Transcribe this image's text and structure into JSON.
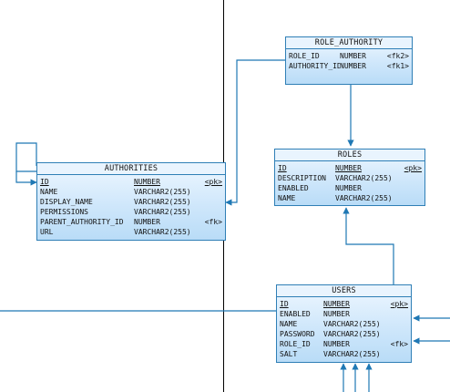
{
  "entities": {
    "role_authority": {
      "title": "ROLE_AUTHORITY",
      "columns": [
        {
          "name": "ROLE_ID",
          "type": "NUMBER",
          "key": "<fk2>",
          "pk": false
        },
        {
          "name": "AUTHORITY_ID",
          "type": "NUMBER",
          "key": "<fk1>",
          "pk": false
        }
      ]
    },
    "authorities": {
      "title": "AUTHORITIES",
      "columns": [
        {
          "name": "ID",
          "type": "NUMBER",
          "key": "<pk>",
          "pk": true
        },
        {
          "name": "NAME",
          "type": "VARCHAR2(255)",
          "key": "",
          "pk": false
        },
        {
          "name": "DISPLAY_NAME",
          "type": "VARCHAR2(255)",
          "key": "",
          "pk": false
        },
        {
          "name": "PERMISSIONS",
          "type": "VARCHAR2(255)",
          "key": "",
          "pk": false
        },
        {
          "name": "PARENT_AUTHORITY_ID",
          "type": "NUMBER",
          "key": "<fk>",
          "pk": false
        },
        {
          "name": "URL",
          "type": "VARCHAR2(255)",
          "key": "",
          "pk": false
        }
      ]
    },
    "roles": {
      "title": "ROLES",
      "columns": [
        {
          "name": "ID",
          "type": "NUMBER",
          "key": "<pk>",
          "pk": true
        },
        {
          "name": "DESCRIPTION",
          "type": "VARCHAR2(255)",
          "key": "",
          "pk": false
        },
        {
          "name": "ENABLED",
          "type": "NUMBER",
          "key": "",
          "pk": false
        },
        {
          "name": "NAME",
          "type": "VARCHAR2(255)",
          "key": "",
          "pk": false
        }
      ]
    },
    "users": {
      "title": "USERS",
      "columns": [
        {
          "name": "ID",
          "type": "NUMBER",
          "key": "<pk>",
          "pk": true
        },
        {
          "name": "ENABLED",
          "type": "NUMBER",
          "key": "",
          "pk": false
        },
        {
          "name": "NAME",
          "type": "VARCHAR2(255)",
          "key": "",
          "pk": false
        },
        {
          "name": "PASSWORD",
          "type": "VARCHAR2(255)",
          "key": "",
          "pk": false
        },
        {
          "name": "ROLE_ID",
          "type": "NUMBER",
          "key": "<fk>",
          "pk": false
        },
        {
          "name": "SALT",
          "type": "VARCHAR2(255)",
          "key": "",
          "pk": false
        }
      ]
    }
  },
  "colors": {
    "line": "#1f78b4",
    "divider": "#000000",
    "entity_border": "#2f7fb6"
  }
}
